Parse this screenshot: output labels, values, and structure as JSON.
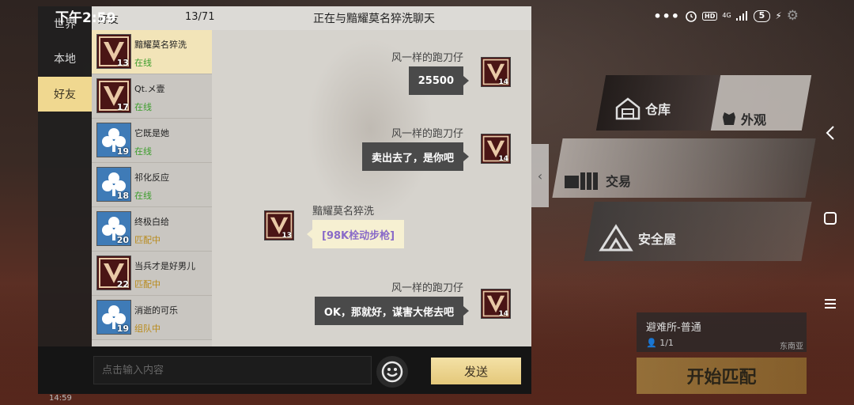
{
  "status_bar": {
    "time": "下午2:59",
    "network": "4G",
    "battery": "5"
  },
  "side_tabs": [
    {
      "label": "世界",
      "active": false
    },
    {
      "label": "本地",
      "active": false
    },
    {
      "label": "好友",
      "active": true
    }
  ],
  "header": {
    "tab_label": "好友",
    "count": "13/71",
    "title": "正在与黯耀莫名猝洗聊天"
  },
  "friends": [
    {
      "name": "黯耀莫名猝洗",
      "level": "13",
      "status": "在线",
      "avatar": "v-badge",
      "selected": true
    },
    {
      "name": "Qt.メ壹",
      "level": "17",
      "status": "在线",
      "avatar": "v-badge",
      "selected": false
    },
    {
      "name": "它既是她",
      "level": "19",
      "status": "在线",
      "avatar": "club-badge",
      "selected": false
    },
    {
      "name": "祁化反应",
      "level": "18",
      "status": "在线",
      "avatar": "club-badge",
      "selected": false
    },
    {
      "name": "终极白给",
      "level": "20",
      "status": "匹配中",
      "avatar": "club-badge",
      "selected": false
    },
    {
      "name": "当兵才是好男儿",
      "level": "22",
      "status": "匹配中",
      "avatar": "v-badge",
      "selected": false
    },
    {
      "name": "消逝的可乐",
      "level": "19",
      "status": "组队中",
      "avatar": "club-badge",
      "selected": false
    }
  ],
  "messages": [
    {
      "sender": "风一样的跑刀仔",
      "text": "25500",
      "side": "right",
      "level": "14"
    },
    {
      "sender": "风一样的跑刀仔",
      "text": "卖出去了，是你吧",
      "side": "right",
      "level": "14"
    },
    {
      "sender": "黯耀莫名猝洗",
      "text": "[98K栓动步枪]",
      "side": "left",
      "level": "13"
    },
    {
      "sender": "风一样的跑刀仔",
      "text": "OK，那就好，谋害大佬去吧",
      "side": "right",
      "level": "14"
    }
  ],
  "input": {
    "placeholder": "点击输入内容",
    "value": ""
  },
  "send_label": "发送",
  "lobby": {
    "warehouse": "仓库",
    "appearance": "外观",
    "trade": "交易",
    "safehouse": "安全屋",
    "shelter_title": "避难所-普通",
    "shelter_count": "1/1",
    "shelter_region": "东南亚",
    "start_match": "开始匹配",
    "bottom_clock": "14:59"
  },
  "colors": {
    "online": "#3c9d2c",
    "matching": "#b88a1a",
    "send_button": "#e4c87a",
    "active_tab": "#f0d890"
  }
}
